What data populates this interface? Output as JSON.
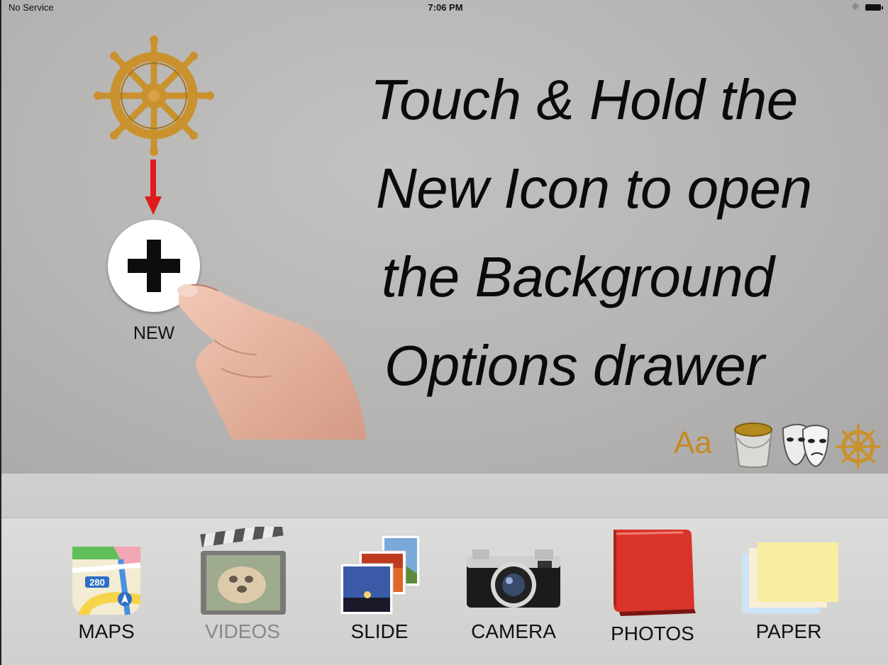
{
  "status_bar": {
    "carrier": "No Service",
    "time": "7:06 PM"
  },
  "canvas": {
    "headline_lines": [
      "Touch & Hold the",
      "New Icon to open",
      "the Background",
      "Options drawer"
    ],
    "new_button_label": "NEW",
    "tools": {
      "text_tool_label": "Aa"
    }
  },
  "dock": {
    "items": [
      {
        "label": "MAPS",
        "icon": "maps-icon",
        "enabled": true
      },
      {
        "label": "VIDEOS",
        "icon": "clapperboard-icon",
        "enabled": false
      },
      {
        "label": "SLIDE",
        "icon": "slideshow-icon",
        "enabled": true
      },
      {
        "label": "CAMERA",
        "icon": "camera-icon",
        "enabled": true
      },
      {
        "label": "PHOTOS",
        "icon": "photo-album-icon",
        "enabled": true
      },
      {
        "label": "PAPER",
        "icon": "paper-icon",
        "enabled": true
      }
    ]
  },
  "colors": {
    "accent_gold": "#c48a22",
    "arrow_red": "#e01b1b",
    "canvas_gray": "#b6b5b3"
  }
}
